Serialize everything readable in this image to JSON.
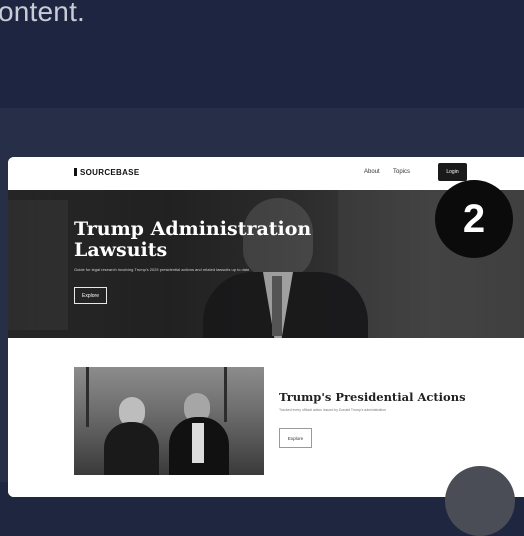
{
  "caption": "ontent.",
  "site": {
    "logo": "SOURCEBASE",
    "nav": {
      "about": "About",
      "topics": "Topics",
      "login": "Login"
    },
    "hero": {
      "title": "Trump Administration Lawsuits",
      "subtitle": "Guide for legal research involving Trump's 2025 presidential actions and related lawsuits up to date",
      "button": "Explore"
    },
    "feature": {
      "title": "Trump's Presidential Actions",
      "subtitle": "Tracked every official action issued by Donald Trump's administration",
      "button": "Explore"
    }
  },
  "step_badge": "2"
}
